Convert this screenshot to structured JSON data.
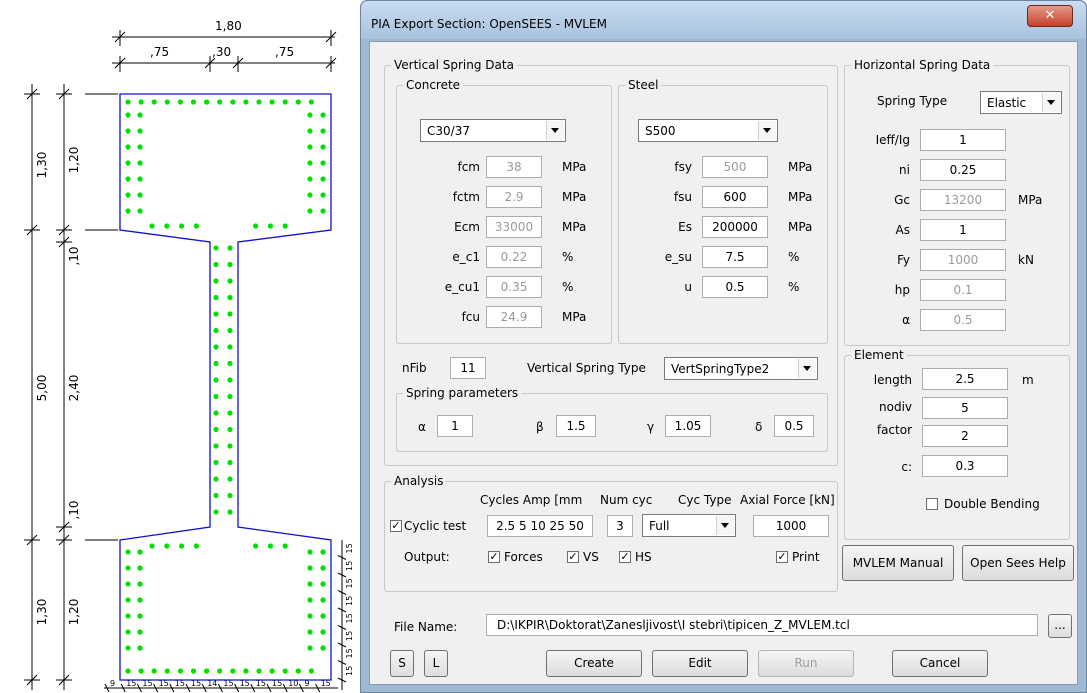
{
  "drawing": {
    "dims_top": {
      "total": "1,80",
      "left": ",75",
      "mid": ",30",
      "right": ",75"
    },
    "dims_left_outer": {
      "total": "5,00",
      "top": "1,30",
      "bottom": "1,30"
    },
    "dims_left_inner": {
      "top": "1,20",
      "upper_fillet": ",10",
      "web": "2,40",
      "lower_fillet": ",10",
      "bottom": "1,20"
    },
    "dims_bottom": [
      "9",
      "15",
      "15",
      "15",
      "15",
      "15",
      "14",
      "15",
      "15",
      "15",
      "15",
      "10",
      "9",
      "15"
    ],
    "dims_right": [
      "15",
      "15",
      "15",
      "15",
      "15",
      "15",
      "15",
      "15"
    ],
    "colors": {
      "outline": "#1010d0",
      "bars": "#00e000",
      "dim": "#000000"
    }
  },
  "window": {
    "title": "PIA Export Section: OpenSEES - MVLEM",
    "close_icon": "close-icon"
  },
  "vertical": {
    "title": "Vertical Spring Data",
    "concrete": {
      "title": "Concrete",
      "material": "C30/37",
      "rows": [
        {
          "label": "fcm",
          "value": "38",
          "unit": "MPa",
          "enabled": false
        },
        {
          "label": "fctm",
          "value": "2.9",
          "unit": "MPa",
          "enabled": false
        },
        {
          "label": "Ecm",
          "value": "33000",
          "unit": "MPa",
          "enabled": false
        },
        {
          "label": "e_c1",
          "value": "0.22",
          "unit": "%",
          "enabled": false
        },
        {
          "label": "e_cu1",
          "value": "0.35",
          "unit": "%",
          "enabled": false
        },
        {
          "label": "fcu",
          "value": "24.9",
          "unit": "MPa",
          "enabled": false
        }
      ]
    },
    "steel": {
      "title": "Steel",
      "material": "S500",
      "rows": [
        {
          "label": "fsy",
          "value": "500",
          "unit": "MPa",
          "enabled": false
        },
        {
          "label": "fsu",
          "value": "600",
          "unit": "MPa",
          "enabled": true
        },
        {
          "label": "Es",
          "value": "200000",
          "unit": "MPa",
          "enabled": true
        },
        {
          "label": "e_su",
          "value": "7.5",
          "unit": "%",
          "enabled": true
        },
        {
          "label": "u",
          "value": "0.5",
          "unit": "%",
          "enabled": true
        }
      ]
    },
    "nfib_label": "nFib",
    "nfib": "11",
    "spring_type_label": "Vertical Spring Type",
    "spring_type": "VertSpringType2",
    "params": {
      "title": "Spring parameters",
      "alpha_label": "α",
      "alpha": "1",
      "beta_label": "β",
      "beta": "1.5",
      "gamma_label": "γ",
      "gamma": "1.05",
      "delta_label": "δ",
      "delta": "0.5"
    }
  },
  "horizontal": {
    "title": "Horizontal Spring Data",
    "spring_type_label": "Spring Type",
    "spring_type": "Elastic",
    "rows": [
      {
        "label": "Ieff/Ig",
        "value": "1",
        "unit": "",
        "enabled": true
      },
      {
        "label": "ni",
        "value": "0.25",
        "unit": "",
        "enabled": true
      },
      {
        "label": "Gc",
        "value": "13200",
        "unit": "MPa",
        "enabled": false
      },
      {
        "label": "As",
        "value": "1",
        "unit": "",
        "enabled": true
      },
      {
        "label": "Fy",
        "value": "1000",
        "unit": "kN",
        "enabled": false
      },
      {
        "label": "hp",
        "value": "0.1",
        "unit": "",
        "enabled": false
      },
      {
        "label": "α",
        "value": "0.5",
        "unit": "",
        "enabled": false
      }
    ]
  },
  "element": {
    "title": "Element",
    "length_label": "length",
    "length": "2.5",
    "length_unit": "m",
    "nodiv_label": "nodiv",
    "nodiv": "5",
    "factor_label": "factor",
    "factor": "2",
    "c_label": "c:",
    "c": "0.3",
    "double_bending_label": "Double Bending",
    "double_bending": false
  },
  "analysis": {
    "title": "Analysis",
    "hdr_amp": "Cycles Amp [mm",
    "hdr_num": "Num cyc",
    "hdr_type": "Cyc Type",
    "hdr_axial": "Axial Force [kN]",
    "cyclic_label": "Cyclic test",
    "cyclic": true,
    "amp": "2.5 5 10 25 50",
    "num": "3",
    "type": "Full",
    "axial": "1000",
    "output_label": "Output:",
    "forces_label": "Forces",
    "vs_label": "VS",
    "hs_label": "HS",
    "print_label": "Print"
  },
  "buttons": {
    "manual": "MVLEM Manual",
    "help": "Open Sees Help",
    "s": "S",
    "l": "L",
    "create": "Create",
    "edit": "Edit",
    "run": "Run",
    "cancel": "Cancel",
    "browse": "..."
  },
  "file": {
    "label": "File Name:",
    "path": "D:\\IKPIR\\Doktorat\\Zanesljivost\\I stebri\\tipicen_Z_MVLEM.tcl"
  }
}
